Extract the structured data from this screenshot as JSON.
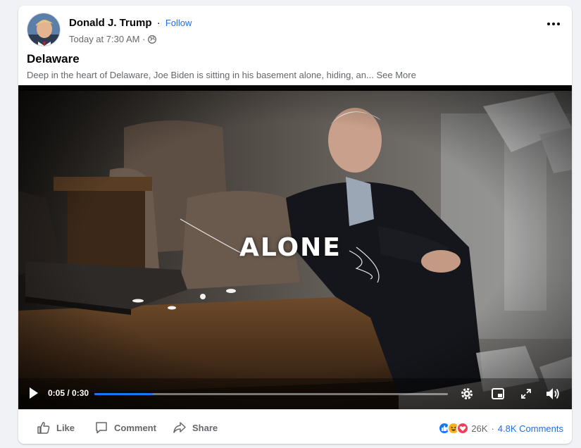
{
  "post": {
    "author": "Donald J. Trump",
    "separator": "·",
    "follow_label": "Follow",
    "timestamp": "Today at 7:30 AM ·",
    "title": "Delaware",
    "description": "Deep in the heart of Delaware, Joe Biden is sitting in his basement alone, hiding, an...",
    "see_more": "See More"
  },
  "video": {
    "overlay_text": "ALONE",
    "current_time": "0:05",
    "duration": "0:30",
    "time_display": "0:05 / 0:30",
    "progress_fraction": 0.165
  },
  "actions": {
    "like_label": "Like",
    "comment_label": "Comment",
    "share_label": "Share"
  },
  "reactions": {
    "count": "26K",
    "separator": "·",
    "comments": "4.8K Comments",
    "icons": [
      "like-icon",
      "haha-icon",
      "love-icon"
    ]
  },
  "colors": {
    "accent": "#216fdb",
    "progress": "#1877f2",
    "muted": "#65676b",
    "like_blue": "#1877f2",
    "love_red": "#f33e58",
    "haha_yellow": "#f7b125"
  }
}
